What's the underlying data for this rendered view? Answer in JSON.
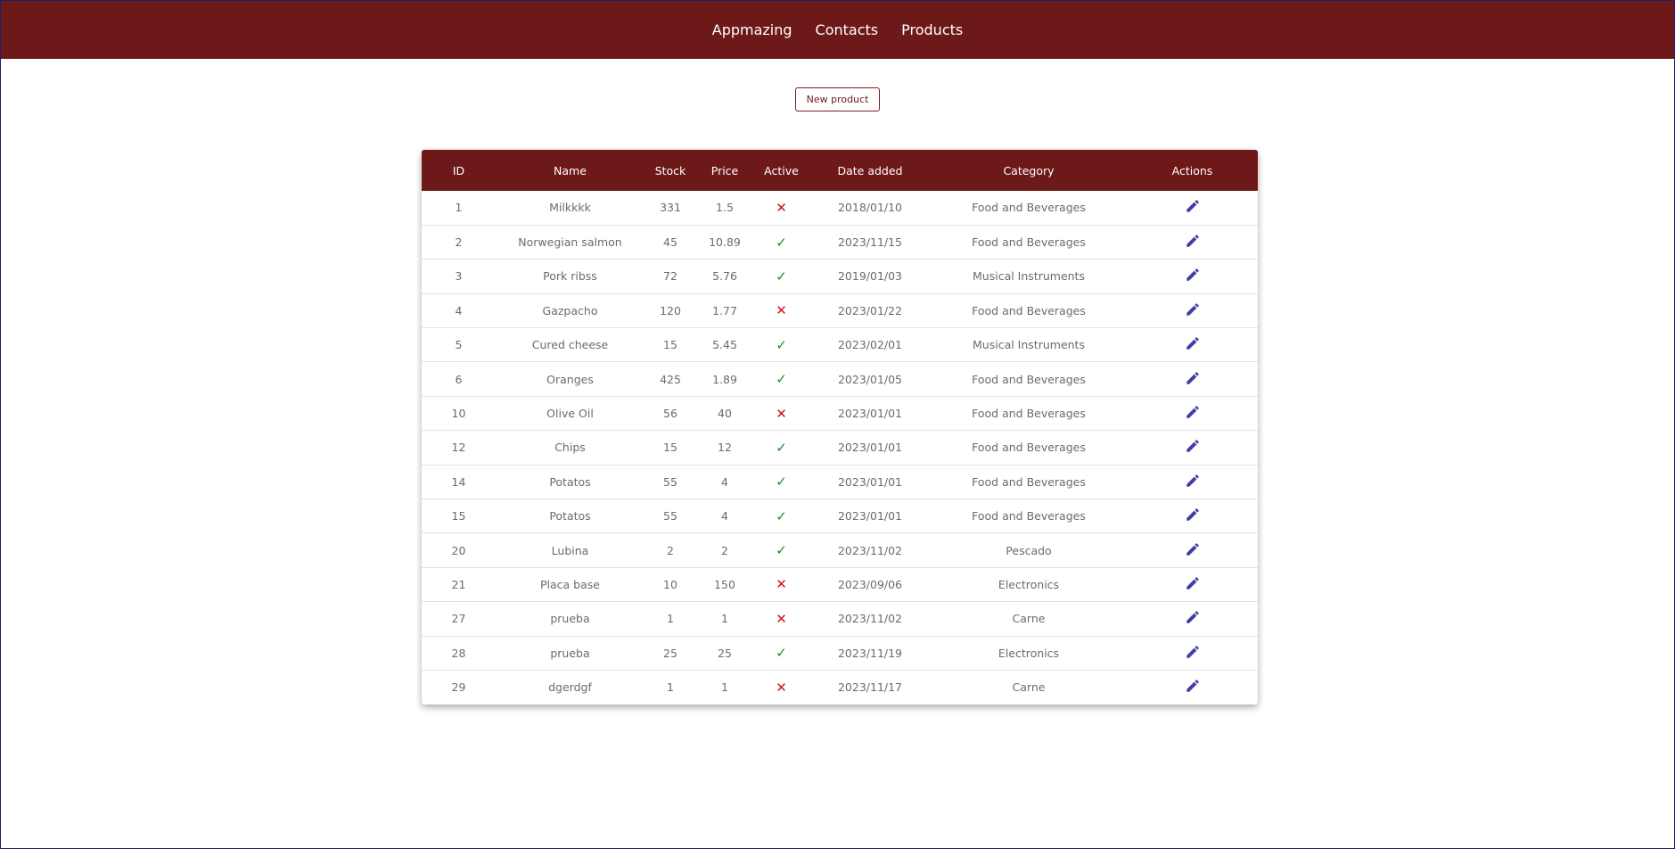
{
  "nav": {
    "links": [
      "Appmazing",
      "Contacts",
      "Products"
    ]
  },
  "toolbar": {
    "new_product_label": "New product"
  },
  "colors": {
    "brand": "#6e1919",
    "active_true": "#1f8a2c",
    "active_false": "#d0141a",
    "edit_icon": "#3f3fa6"
  },
  "table": {
    "columns": [
      "ID",
      "Name",
      "Stock",
      "Price",
      "Active",
      "Date added",
      "Category",
      "Actions"
    ],
    "rows": [
      {
        "id": "1",
        "name": "Milkkkk",
        "stock": "331",
        "price": "1.5",
        "active": false,
        "date": "2018/01/10",
        "category": "Food and Beverages"
      },
      {
        "id": "2",
        "name": "Norwegian salmon",
        "stock": "45",
        "price": "10.89",
        "active": true,
        "date": "2023/11/15",
        "category": "Food and Beverages"
      },
      {
        "id": "3",
        "name": "Pork ribss",
        "stock": "72",
        "price": "5.76",
        "active": true,
        "date": "2019/01/03",
        "category": "Musical Instruments"
      },
      {
        "id": "4",
        "name": "Gazpacho",
        "stock": "120",
        "price": "1.77",
        "active": false,
        "date": "2023/01/22",
        "category": "Food and Beverages"
      },
      {
        "id": "5",
        "name": "Cured cheese",
        "stock": "15",
        "price": "5.45",
        "active": true,
        "date": "2023/02/01",
        "category": "Musical Instruments"
      },
      {
        "id": "6",
        "name": "Oranges",
        "stock": "425",
        "price": "1.89",
        "active": true,
        "date": "2023/01/05",
        "category": "Food and Beverages"
      },
      {
        "id": "10",
        "name": "Olive Oil",
        "stock": "56",
        "price": "40",
        "active": false,
        "date": "2023/01/01",
        "category": "Food and Beverages"
      },
      {
        "id": "12",
        "name": "Chips",
        "stock": "15",
        "price": "12",
        "active": true,
        "date": "2023/01/01",
        "category": "Food and Beverages"
      },
      {
        "id": "14",
        "name": "Potatos",
        "stock": "55",
        "price": "4",
        "active": true,
        "date": "2023/01/01",
        "category": "Food and Beverages"
      },
      {
        "id": "15",
        "name": "Potatos",
        "stock": "55",
        "price": "4",
        "active": true,
        "date": "2023/01/01",
        "category": "Food and Beverages"
      },
      {
        "id": "20",
        "name": "Lubina",
        "stock": "2",
        "price": "2",
        "active": true,
        "date": "2023/11/02",
        "category": "Pescado"
      },
      {
        "id": "21",
        "name": "Placa base",
        "stock": "10",
        "price": "150",
        "active": false,
        "date": "2023/09/06",
        "category": "Electronics"
      },
      {
        "id": "27",
        "name": "prueba",
        "stock": "1",
        "price": "1",
        "active": false,
        "date": "2023/11/02",
        "category": "Carne"
      },
      {
        "id": "28",
        "name": "prueba",
        "stock": "25",
        "price": "25",
        "active": true,
        "date": "2023/11/19",
        "category": "Electronics"
      },
      {
        "id": "29",
        "name": "dgerdgf",
        "stock": "1",
        "price": "1",
        "active": false,
        "date": "2023/11/17",
        "category": "Carne"
      }
    ]
  }
}
